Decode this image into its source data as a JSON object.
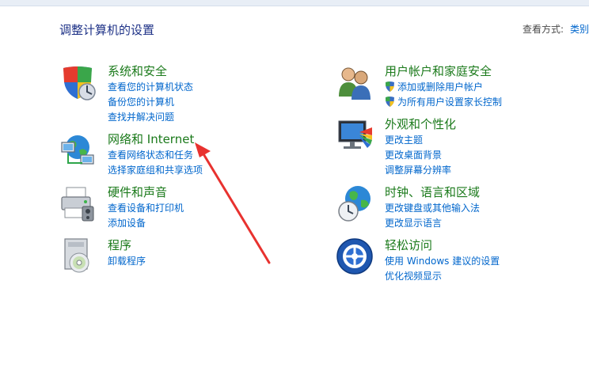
{
  "header": {
    "title": "调整计算机的设置",
    "view_by_label": "查看方式:",
    "view_by_value": "类别"
  },
  "categories": [
    {
      "title": "系统和安全",
      "icon": "shield-icon",
      "links": [
        "查看您的计算机状态",
        "备份您的计算机",
        "查找并解决问题"
      ]
    },
    {
      "title": "网络和 Internet",
      "icon": "network-icon",
      "links": [
        "查看网络状态和任务",
        "选择家庭组和共享选项"
      ]
    },
    {
      "title": "硬件和声音",
      "icon": "printer-icon",
      "links": [
        "查看设备和打印机",
        "添加设备"
      ]
    },
    {
      "title": "程序",
      "icon": "programs-icon",
      "links": [
        "卸载程序"
      ]
    },
    {
      "title": "用户帐户和家庭安全",
      "icon": "users-icon",
      "links": [
        "添加或删除用户帐户",
        "为所有用户设置家长控制"
      ]
    },
    {
      "title": "外观和个性化",
      "icon": "appearance-icon",
      "links": [
        "更改主题",
        "更改桌面背景",
        "调整屏幕分辨率"
      ]
    },
    {
      "title": "时钟、语言和区域",
      "icon": "clock-globe-icon",
      "links": [
        "更改键盘或其他输入法",
        "更改显示语言"
      ]
    },
    {
      "title": "轻松访问",
      "icon": "ease-of-access-icon",
      "links": [
        "使用 Windows 建议的设置",
        "优化视频显示"
      ]
    }
  ],
  "annotation": {
    "arrow_color": "#e8322f"
  }
}
